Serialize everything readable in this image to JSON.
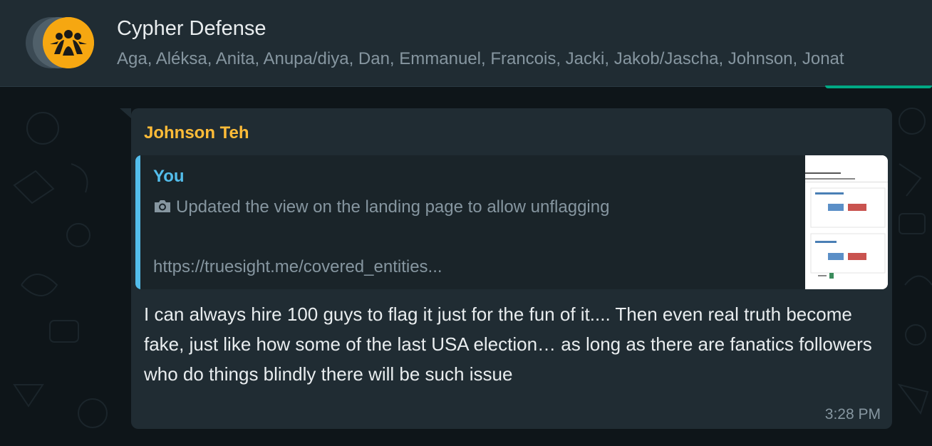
{
  "chat": {
    "title": "Cypher Defense",
    "members": "Aga, Aléksa, Anita, Anupa/diya, Dan, Emmanuel, Francois, Jacki, Jakob/Jascha, Johnson, Jonat"
  },
  "message": {
    "sender": "Johnson Teh",
    "quote": {
      "author": "You",
      "icon": "camera-icon",
      "text": "Updated the view on the landing page to allow unflagging",
      "url": "https://truesight.me/covered_entities..."
    },
    "body": "I can always hire 100 guys to flag it just for the fun of it.... Then even real truth become fake, just like how some of the last USA election… as long as there are fanatics followers who do things blindly there will be such issue",
    "time": "3:28 PM"
  },
  "colors": {
    "header_bg": "#202c33",
    "bubble_bg": "#202c33",
    "sender_color": "#ffbc38",
    "quote_accent": "#53bdeb",
    "avatar_bg": "#f6a711"
  }
}
